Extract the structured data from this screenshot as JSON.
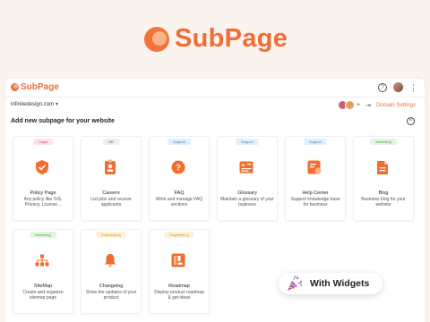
{
  "brand": {
    "name": "SubPage",
    "accent": "#ef6d38"
  },
  "topbar": {
    "help_icon": "?",
    "more_icon": "⋮"
  },
  "subbar": {
    "domain": "infinitedesign.com",
    "team_plus": "+",
    "domain_settings": "Domain Settings"
  },
  "section": {
    "title": "Add new subpage for your website",
    "close_icon": "×"
  },
  "cards": [
    {
      "tag": "Legal",
      "tag_bg": "#fde3ef",
      "tag_color": "#c2446f",
      "title": "Policy Page",
      "desc": "Any policy like ToS, Privacy, License...",
      "icon": "shield-check-icon"
    },
    {
      "tag": "HR",
      "tag_bg": "#ececf3",
      "tag_color": "#5a5a77",
      "title": "Careers",
      "desc": "List jobs and receive applicants",
      "icon": "badge-icon"
    },
    {
      "tag": "Support",
      "tag_bg": "#e2f0fd",
      "tag_color": "#3b7fc4",
      "title": "FAQ",
      "desc": "Write and manage FAQ sections",
      "icon": "question-icon"
    },
    {
      "tag": "Support",
      "tag_bg": "#e2f0fd",
      "tag_color": "#3b7fc4",
      "title": "Glossary",
      "desc": "Maintain a glossary of your business",
      "icon": "glossary-icon"
    },
    {
      "tag": "Support",
      "tag_bg": "#e2f0fd",
      "tag_color": "#3b7fc4",
      "title": "Help Center",
      "desc": "Support knowledge base for business",
      "icon": "help-center-icon"
    },
    {
      "tag": "Marketing",
      "tag_bg": "#e3f5e1",
      "tag_color": "#4e9d45",
      "title": "Blog",
      "desc": "Business blog for your website",
      "icon": "document-icon"
    },
    {
      "tag": "Marketing",
      "tag_bg": "#e3f5e1",
      "tag_color": "#4e9d45",
      "title": "SiteMap",
      "desc": "Create and organize sitemap page",
      "icon": "sitemap-icon"
    },
    {
      "tag": "Engineering",
      "tag_bg": "#fdf2d7",
      "tag_color": "#c9951c",
      "title": "Changelog",
      "desc": "Show the updates of your product",
      "icon": "bell-icon"
    },
    {
      "tag": "Engineering",
      "tag_bg": "#fdf2d7",
      "tag_color": "#c9951c",
      "title": "Roadmap",
      "desc": "Display product roadmap & get ideas",
      "icon": "roadmap-icon"
    }
  ],
  "widgets_pill": {
    "label": "With Widgets",
    "icon": "party-popper-icon"
  }
}
